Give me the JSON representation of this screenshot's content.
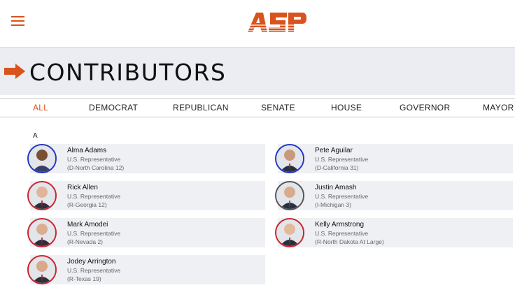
{
  "header": {
    "logo_text": "ASP",
    "accent_color": "#d9531e"
  },
  "page": {
    "title": "CONTRIBUTORS"
  },
  "tabs": [
    "ALL",
    "DEMOCRAT",
    "REPUBLICAN",
    "SENATE",
    "HOUSE",
    "GOVERNOR",
    "MAYOR"
  ],
  "active_tab": "ALL",
  "section_letter": "A",
  "contributors": [
    {
      "name": "Alma Adams",
      "role": "U.S. Representative",
      "district": "(D-North Carolina 12)",
      "party": "D"
    },
    {
      "name": "Pete Aguilar",
      "role": "U.S. Representative",
      "district": "(D-California 31)",
      "party": "D"
    },
    {
      "name": "Rick Allen",
      "role": "U.S. Representative",
      "district": "(R-Georgia 12)",
      "party": "R"
    },
    {
      "name": "Justin Amash",
      "role": "U.S. Representative",
      "district": "(I-Michigan 3)",
      "party": "I"
    },
    {
      "name": "Mark Amodei",
      "role": "U.S. Representative",
      "district": "(R-Nevada 2)",
      "party": "R"
    },
    {
      "name": "Kelly Armstrong",
      "role": "U.S. Representative",
      "district": "(R-North Dakota At Large)",
      "party": "R"
    },
    {
      "name": "Jodey Arrington",
      "role": "U.S. Representative",
      "district": "(R-Texas 19)",
      "party": "R"
    }
  ]
}
